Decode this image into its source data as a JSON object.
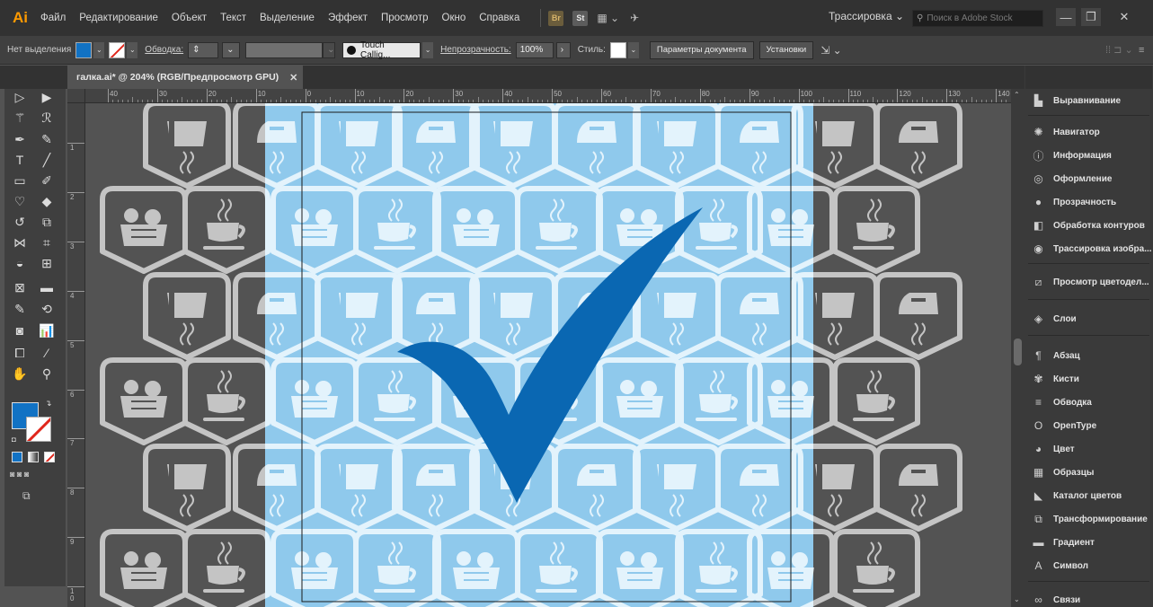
{
  "app": {
    "logo": "Ai"
  },
  "menu": [
    "Файл",
    "Редактирование",
    "Объект",
    "Текст",
    "Выделение",
    "Эффект",
    "Просмотр",
    "Окно",
    "Справка"
  ],
  "badges": {
    "br": "Br",
    "st": "St"
  },
  "trace_dropdown": "Трассировка ⌄",
  "stock_search": {
    "placeholder": "Поиск в Adobe Stock"
  },
  "control": {
    "selection": "Нет выделения",
    "stroke_label": "Обводка:",
    "brush": "Touch Callig...",
    "opacity_label": "Непрозрачность:",
    "opacity_value": "100%",
    "style_label": "Стиль:",
    "doc_settings": "Параметры документа",
    "prefs": "Установки"
  },
  "document": {
    "tab_title": "галка.ai* @ 204% (RGB/Предпросмотр GPU)"
  },
  "ruler": {
    "h": [
      "40",
      "30",
      "20",
      "10",
      "0",
      "10",
      "20",
      "30",
      "40",
      "50",
      "60",
      "70",
      "80",
      "90",
      "100",
      "110",
      "120",
      "130",
      "140"
    ],
    "v": [
      "1",
      "2",
      "3",
      "4",
      "5",
      "6",
      "7",
      "8",
      "9",
      "1\n0"
    ]
  },
  "panels": [
    {
      "label": "Выравнивание",
      "icon": "align-icon"
    },
    {
      "label": "Навигатор",
      "icon": "navigator-icon"
    },
    {
      "label": "Информация",
      "icon": "info-icon"
    },
    {
      "label": "Оформление",
      "icon": "appearance-icon"
    },
    {
      "label": "Прозрачность",
      "icon": "transparency-icon"
    },
    {
      "label": "Обработка контуров",
      "icon": "pathfinder-icon"
    },
    {
      "label": "Трассировка изобра...",
      "icon": "image-trace-icon"
    },
    {
      "label": "Просмотр цветодел...",
      "icon": "separations-icon"
    },
    {
      "label": "Слои",
      "icon": "layers-icon"
    },
    {
      "label": "Абзац",
      "icon": "paragraph-icon"
    },
    {
      "label": "Кисти",
      "icon": "brushes-icon"
    },
    {
      "label": "Обводка",
      "icon": "stroke-icon"
    },
    {
      "label": "OpenType",
      "icon": "opentype-icon"
    },
    {
      "label": "Цвет",
      "icon": "color-icon"
    },
    {
      "label": "Образцы",
      "icon": "swatches-icon"
    },
    {
      "label": "Каталог цветов",
      "icon": "color-guide-icon"
    },
    {
      "label": "Трансформирование",
      "icon": "transform-icon"
    },
    {
      "label": "Градиент",
      "icon": "gradient-icon"
    },
    {
      "label": "Символ",
      "icon": "character-icon"
    },
    {
      "label": "Связи",
      "icon": "links-icon"
    }
  ],
  "colors": {
    "fill": "#1172c4",
    "checkmark": "#0a67b2",
    "highlight": "#8fc9ec",
    "badge_gray": "#c4c4c4",
    "ui_dark": "#323232"
  }
}
